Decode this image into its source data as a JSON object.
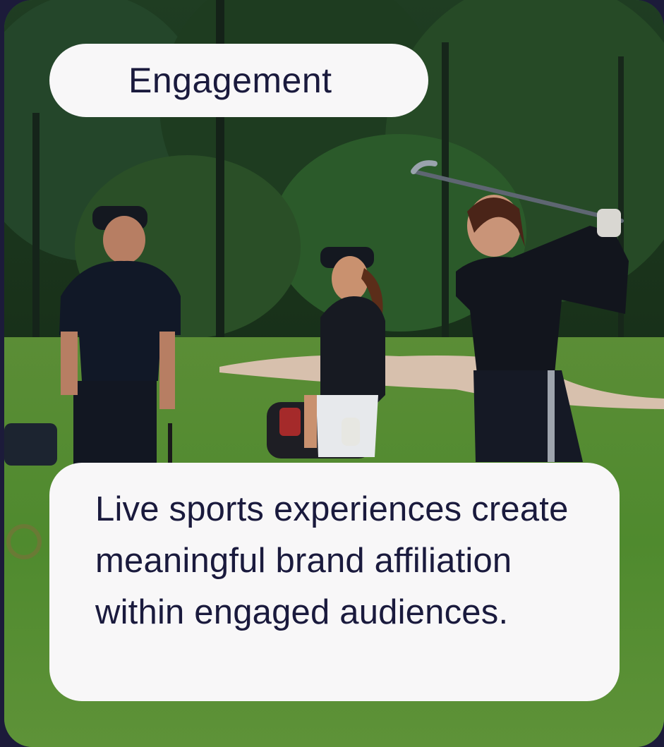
{
  "card": {
    "tag_label": "Engagement",
    "caption": "Live sports experiences create meaningful brand affiliation within engaged audiences.",
    "photo_subject": "golfers-on-course"
  },
  "colors": {
    "page_background": "#1c1b3a",
    "pill_background": "#f8f7f8",
    "text": "#1a1a3d"
  }
}
